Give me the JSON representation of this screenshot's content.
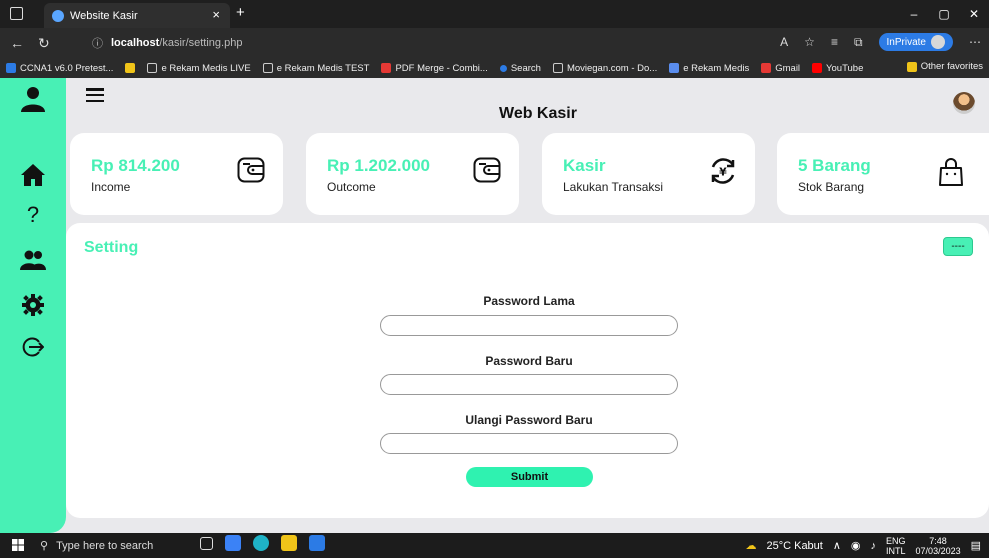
{
  "browser": {
    "tab_title": "Website Kasir",
    "tab_close": "×",
    "new_tab": "+",
    "url_host": "localhost",
    "url_path": "/kasir/setting.php",
    "inprivate_label": "InPrivate",
    "window_controls": [
      "–",
      "▢",
      "✕"
    ],
    "favorites": [
      {
        "label": "CCNA1 v6.0 Pretest...",
        "color": "#2c7be5"
      },
      {
        "label": "",
        "color": "#f0c419"
      },
      {
        "label": "e Rekam Medis LIVE",
        "color": "#cccccc"
      },
      {
        "label": "e Rekam Medis TEST",
        "color": "#cccccc"
      },
      {
        "label": "PDF Merge - Combi...",
        "color": "#e53935"
      },
      {
        "label": "Search",
        "color": "#2c7be5"
      },
      {
        "label": "Moviegan.com - Do...",
        "color": "#cccccc"
      },
      {
        "label": "e Rekam Medis",
        "color": "#5a8dee"
      },
      {
        "label": "Gmail",
        "color": "#e53935"
      },
      {
        "label": "YouTube",
        "color": "#ff0000"
      }
    ],
    "other_favorites": "Other favorites"
  },
  "app": {
    "brand": "Web Kasir",
    "accent_color": "#48f0b5",
    "sidebar_items": [
      {
        "icon": "user-icon"
      },
      {
        "icon": "home-icon"
      },
      {
        "icon": "help-icon",
        "glyph": "?"
      },
      {
        "icon": "users-icon"
      },
      {
        "icon": "gear-icon"
      },
      {
        "icon": "logout-icon"
      }
    ],
    "cards": [
      {
        "value": "Rp 814.200",
        "label": "Income",
        "icon": "wallet-icon"
      },
      {
        "value": "Rp 1.202.000",
        "label": "Outcome",
        "icon": "wallet-icon"
      },
      {
        "value": "Kasir",
        "label": "Lakukan Transaksi",
        "icon": "yen-exchange-icon"
      },
      {
        "value": "5 Barang",
        "label": "Stok Barang",
        "icon": "shopping-bag-icon"
      }
    ],
    "setting": {
      "title": "Setting",
      "corner_button": "----",
      "fields": [
        {
          "label": "Password Lama",
          "value": ""
        },
        {
          "label": "Password Baru",
          "value": ""
        },
        {
          "label": "Ulangi Password Baru",
          "value": ""
        }
      ],
      "submit_label": "Submit"
    }
  },
  "taskbar": {
    "search_placeholder": "Type here to search",
    "weather": "25°C  Kabut",
    "lang_top": "ENG",
    "lang_bottom": "INTL",
    "time": "7:48",
    "date": "07/03/2023"
  }
}
